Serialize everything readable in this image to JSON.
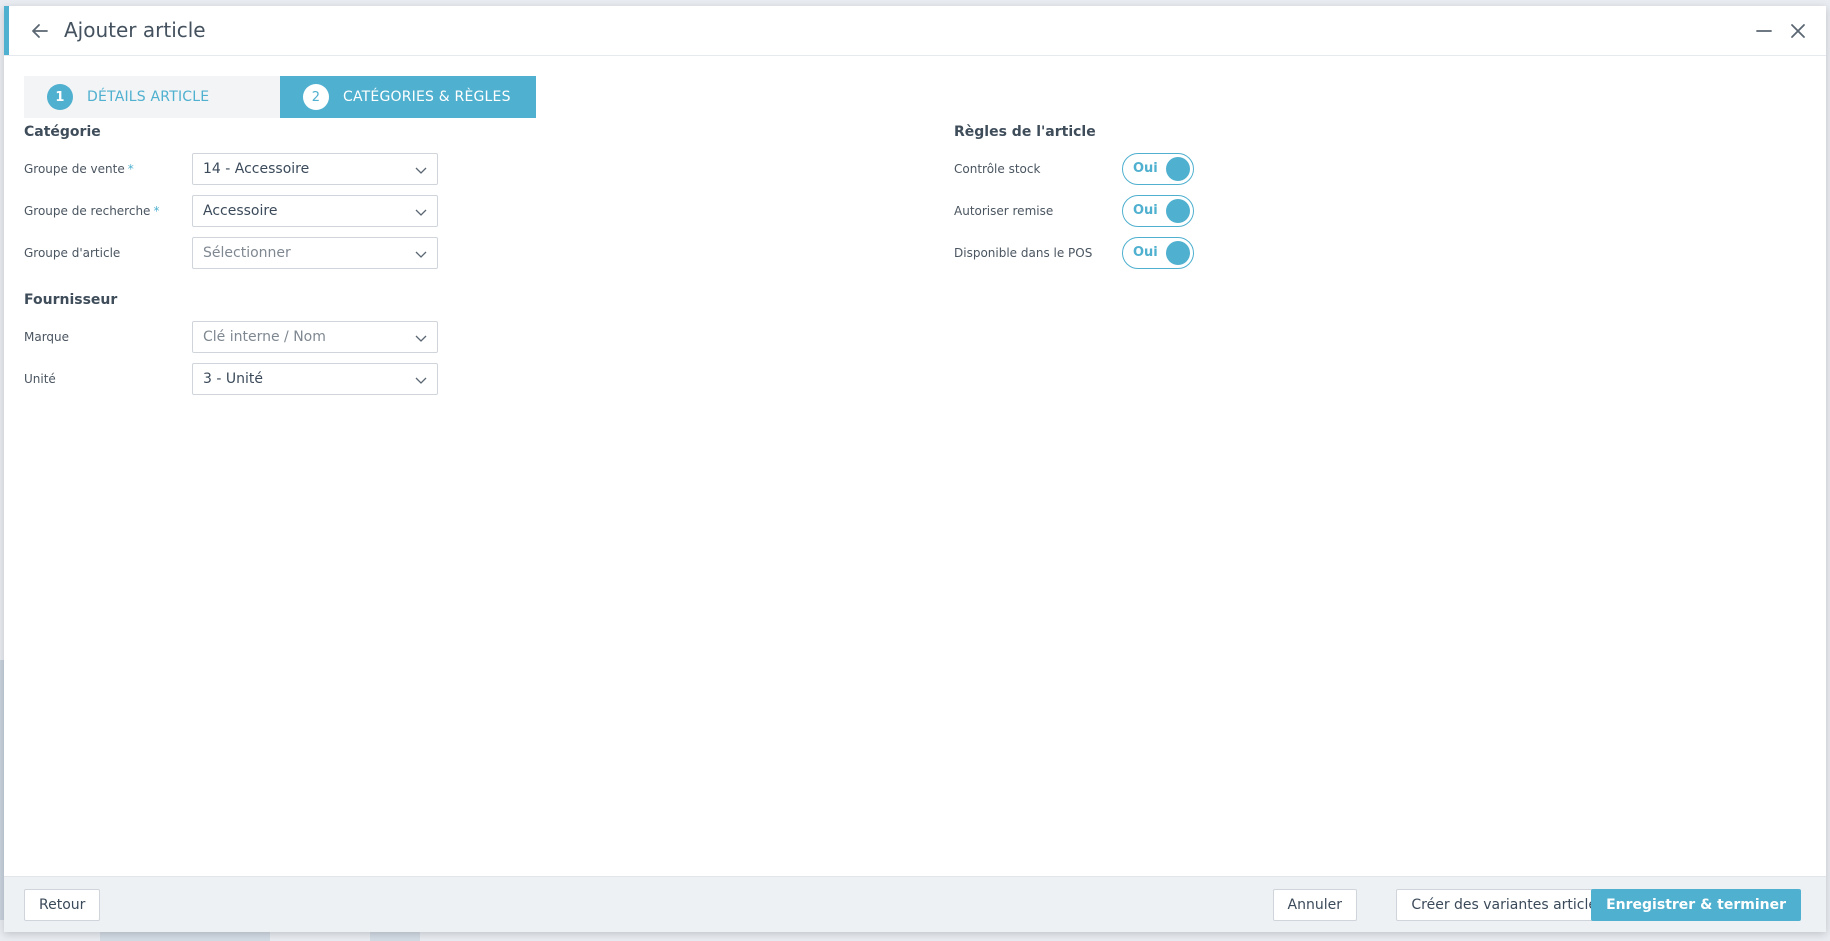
{
  "window": {
    "title": "Ajouter article"
  },
  "icons": {
    "back": "arrow-left-icon",
    "minimize": "minus-icon",
    "close": "close-icon",
    "dropdown": "chevron-down-icon"
  },
  "colors": {
    "accent": "#4fb0cf",
    "step_inactive_bg": "#f2f4f6",
    "footer_bg": "#eef1f4"
  },
  "stepper": {
    "steps": [
      {
        "number": "1",
        "label": "DÉTAILS ARTICLE",
        "active": false
      },
      {
        "number": "2",
        "label": "CATÉGORIES & RÈGLES",
        "active": true
      }
    ]
  },
  "categorie": {
    "title": "Catégorie",
    "fields": [
      {
        "label": "Groupe de vente",
        "required": "*",
        "value": "14 - Accessoire"
      },
      {
        "label": "Groupe de recherche",
        "required": "*",
        "value": "Accessoire"
      },
      {
        "label": "Groupe d'article",
        "placeholder": "Sélectionner"
      }
    ]
  },
  "fournisseur": {
    "title": "Fournisseur",
    "fields": [
      {
        "label": "Marque",
        "placeholder": "Clé interne / Nom"
      },
      {
        "label": "Unité",
        "value": "3 - Unité"
      }
    ]
  },
  "regles": {
    "title": "Règles de l'article",
    "items": [
      {
        "label": "Contrôle stock",
        "toggle": "Oui",
        "on": true
      },
      {
        "label": "Autoriser remise",
        "toggle": "Oui",
        "on": true
      },
      {
        "label": "Disponible dans le POS",
        "toggle": "Oui",
        "on": true
      }
    ]
  },
  "footer": {
    "retour": "Retour",
    "annuler": "Annuler",
    "variantes": "Créer des variantes article",
    "enregistrer": "Enregistrer & terminer"
  }
}
